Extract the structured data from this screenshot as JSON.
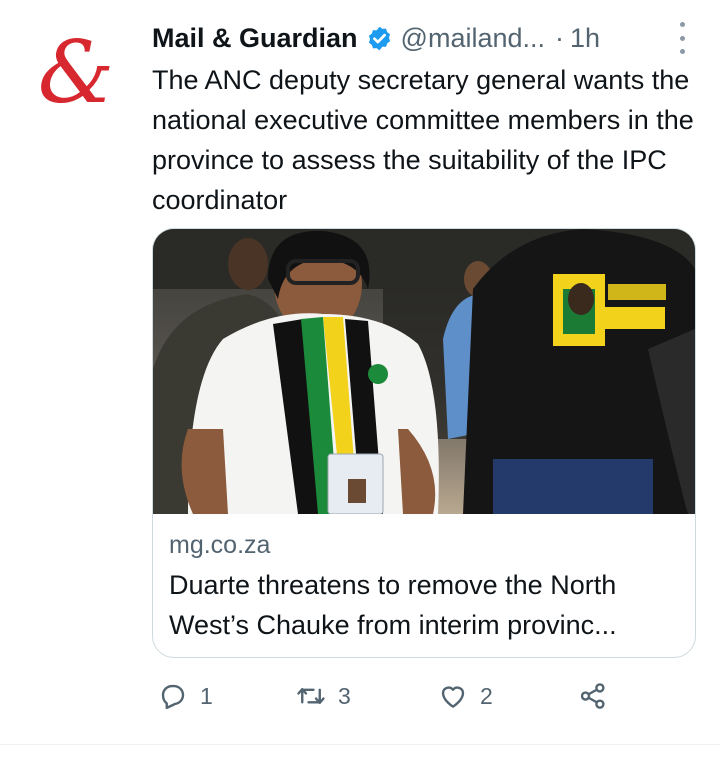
{
  "tweet": {
    "author_name": "Mail & Guardian",
    "handle": "@mailand...",
    "separator": "·",
    "time": "1h",
    "text": "The ANC deputy secretary general wants the national executive committee members in the province to assess the suitability of the IPC coordinator",
    "avatar_glyph": "&",
    "card": {
      "domain": "mg.co.za",
      "title": "Duarte threatens to remove the North West’s Chauke from interim provinc...",
      "image_description_icon": "news-photo"
    },
    "actions": {
      "reply_count": "1",
      "retweet_count": "3",
      "like_count": "2"
    }
  },
  "colors": {
    "brand_red": "#d7282f",
    "verified_blue": "#1d9bf0",
    "muted": "#536471",
    "border": "#cfd9de"
  }
}
